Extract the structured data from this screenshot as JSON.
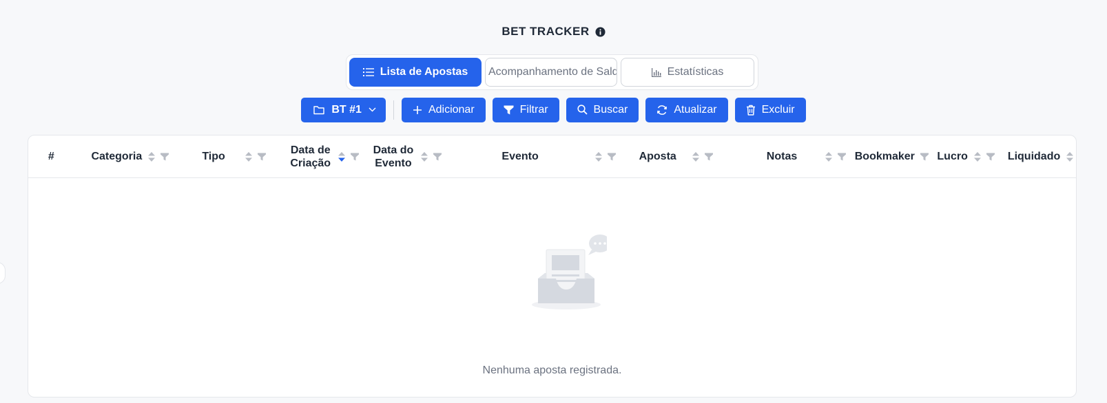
{
  "app": {
    "title": "BET TRACKER"
  },
  "tabs": [
    {
      "label": "Lista de Apostas",
      "active": true,
      "icon": "list-icon"
    },
    {
      "label": "Acompanhamento de Saldo",
      "active": false,
      "icon": ""
    },
    {
      "label": "Estatísticas",
      "active": false,
      "icon": "bar-chart-icon"
    }
  ],
  "toolbar": {
    "tracker_label": "BT #1",
    "add_label": "Adicionar",
    "filter_label": "Filtrar",
    "search_label": "Buscar",
    "refresh_label": "Atualizar",
    "delete_label": "Excluir"
  },
  "table": {
    "columns": [
      {
        "label": "#"
      },
      {
        "label": "Categoria"
      },
      {
        "label": "Tipo"
      },
      {
        "label": "Data de Criação",
        "sorted": "desc"
      },
      {
        "label": "Data do Evento"
      },
      {
        "label": "Evento"
      },
      {
        "label": "Aposta"
      },
      {
        "label": "Notas"
      },
      {
        "label": "Bookmaker"
      },
      {
        "label": "Lucro"
      },
      {
        "label": "Liquidado"
      }
    ],
    "empty_text": "Nenhuma aposta registrada."
  },
  "colors": {
    "primary": "#2563eb",
    "background": "#f7f8fa",
    "border": "#e5e7eb",
    "muted_text": "#6b7280"
  }
}
